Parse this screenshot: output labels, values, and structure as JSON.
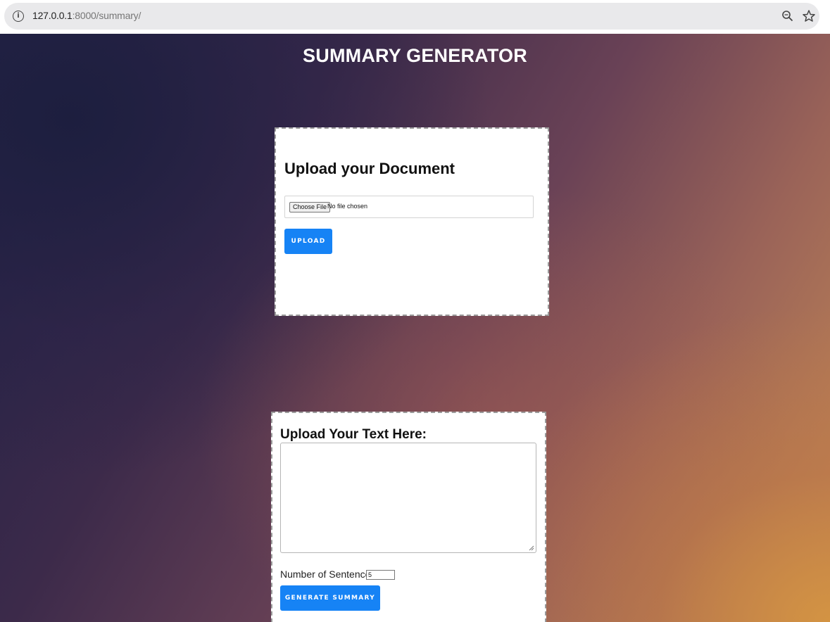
{
  "browser": {
    "url_host": "127.0.0.1",
    "url_path": ":8000/summary/",
    "icons": [
      "info-icon",
      "zoom-icon",
      "star-icon"
    ]
  },
  "page": {
    "title": "SUMMARY GENERATOR"
  },
  "upload_card": {
    "heading": "Upload your Document",
    "choose_file_label": "Choose File",
    "file_status": "No file chosen",
    "upload_button": "UPLOAD"
  },
  "text_card": {
    "heading": "Upload Your Text Here:",
    "textarea_value": "",
    "sentences_label": "Number of Sentences:",
    "sentences_value": "5",
    "generate_button": "GENERATE SUMMARY"
  },
  "colors": {
    "button": "#1683f5",
    "title": "#ffffff"
  }
}
